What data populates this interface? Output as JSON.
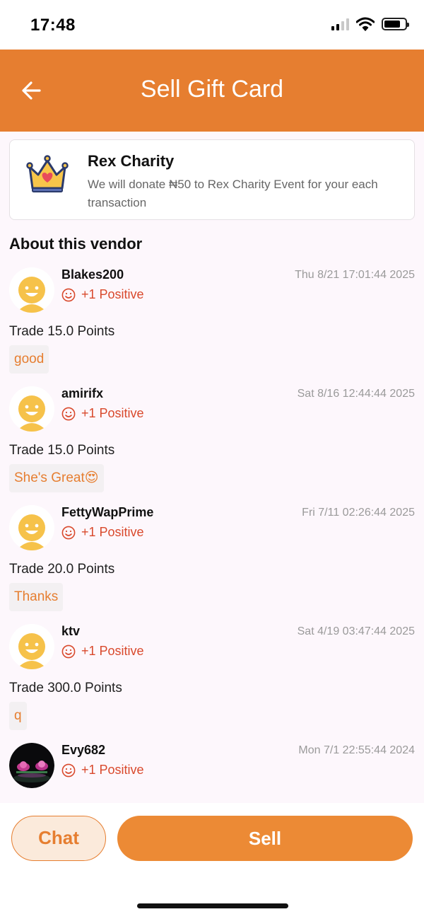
{
  "status_bar": {
    "time": "17:48",
    "battery_level": 0.78
  },
  "header": {
    "title": "Sell Gift Card",
    "back_icon": "arrow-left-icon"
  },
  "charity": {
    "title": "Rex Charity",
    "description": "We will donate ₦50 to Rex Charity Event for your each transaction",
    "icon": "crown-heart-icon"
  },
  "section_title": "About this vendor",
  "reviews": [
    {
      "username": "Blakes200",
      "rating": "+1 Positive",
      "date": "Thu 8/21 17:01:44 2025",
      "trade": "Trade 15.0 Points",
      "comment": "good",
      "avatar": "default-avatar"
    },
    {
      "username": "amirifx",
      "rating": "+1 Positive",
      "date": "Sat 8/16 12:44:44 2025",
      "trade": "Trade 15.0 Points",
      "comment": "She's Great😍",
      "avatar": "default-avatar"
    },
    {
      "username": "FettyWapPrime",
      "rating": "+1 Positive",
      "date": "Fri 7/11 02:26:44 2025",
      "trade": "Trade 20.0 Points",
      "comment": "Thanks",
      "avatar": "default-avatar"
    },
    {
      "username": "ktv",
      "rating": "+1 Positive",
      "date": "Sat 4/19 03:47:44 2025",
      "trade": "Trade 300.0 Points",
      "comment": "q",
      "avatar": "default-avatar"
    },
    {
      "username": "Evy682",
      "rating": "+1 Positive",
      "date": "Mon 7/1 22:55:44 2024",
      "avatar": "photo-avatar"
    }
  ],
  "actions": {
    "chat_label": "Chat",
    "sell_label": "Sell"
  },
  "colors": {
    "brand": "#e67e30",
    "positive": "#d9492c",
    "background": "#fdf7fc"
  }
}
